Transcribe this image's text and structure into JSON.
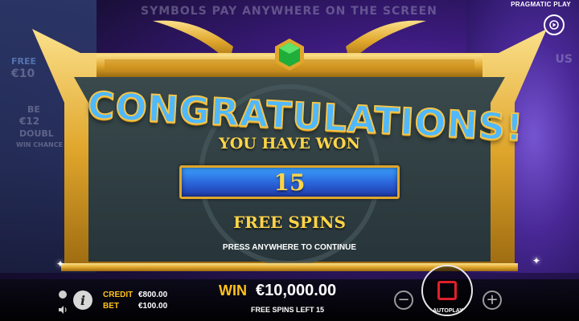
{
  "header": {
    "banner": "SYMBOLS PAY ANYWHERE ON THE SCREEN",
    "brand": "PRAGMATIC PLAY"
  },
  "background": {
    "free_label": "FREE",
    "free_amount": "€10",
    "bet_label": "BE",
    "bet_amount": "€12",
    "double_label": "DOUBL",
    "win_chance": "WIN CHANCE",
    "right_fragment": "US"
  },
  "popup": {
    "title": "CONGRATULATIONS!",
    "subtitle": "YOU HAVE WON",
    "spins_value": "15",
    "spins_label": "FREE SPINS",
    "continue_text": "PRESS ANYWHERE TO CONTINUE"
  },
  "footer": {
    "credit_label": "CREDIT",
    "credit_value": "€800.00",
    "bet_label": "BET",
    "bet_value": "€100.00",
    "win_label": "WIN",
    "win_value": "€10,000.00",
    "spins_left": "FREE SPINS LEFT 15",
    "autoplay_label": "AUTOPLAY",
    "minus": "−",
    "plus": "+",
    "info": "i"
  },
  "colors": {
    "gold": "#ffd548",
    "title_blue": "#4fb8ff",
    "stop_red": "#e0202a",
    "accent_yellow": "#ffc21a"
  },
  "icons": {
    "sound": "sound-icon",
    "menu": "menu-icon",
    "speaker": "speaker-icon",
    "info": "info-icon",
    "gem": "gem-icon",
    "stop": "stop-icon"
  }
}
